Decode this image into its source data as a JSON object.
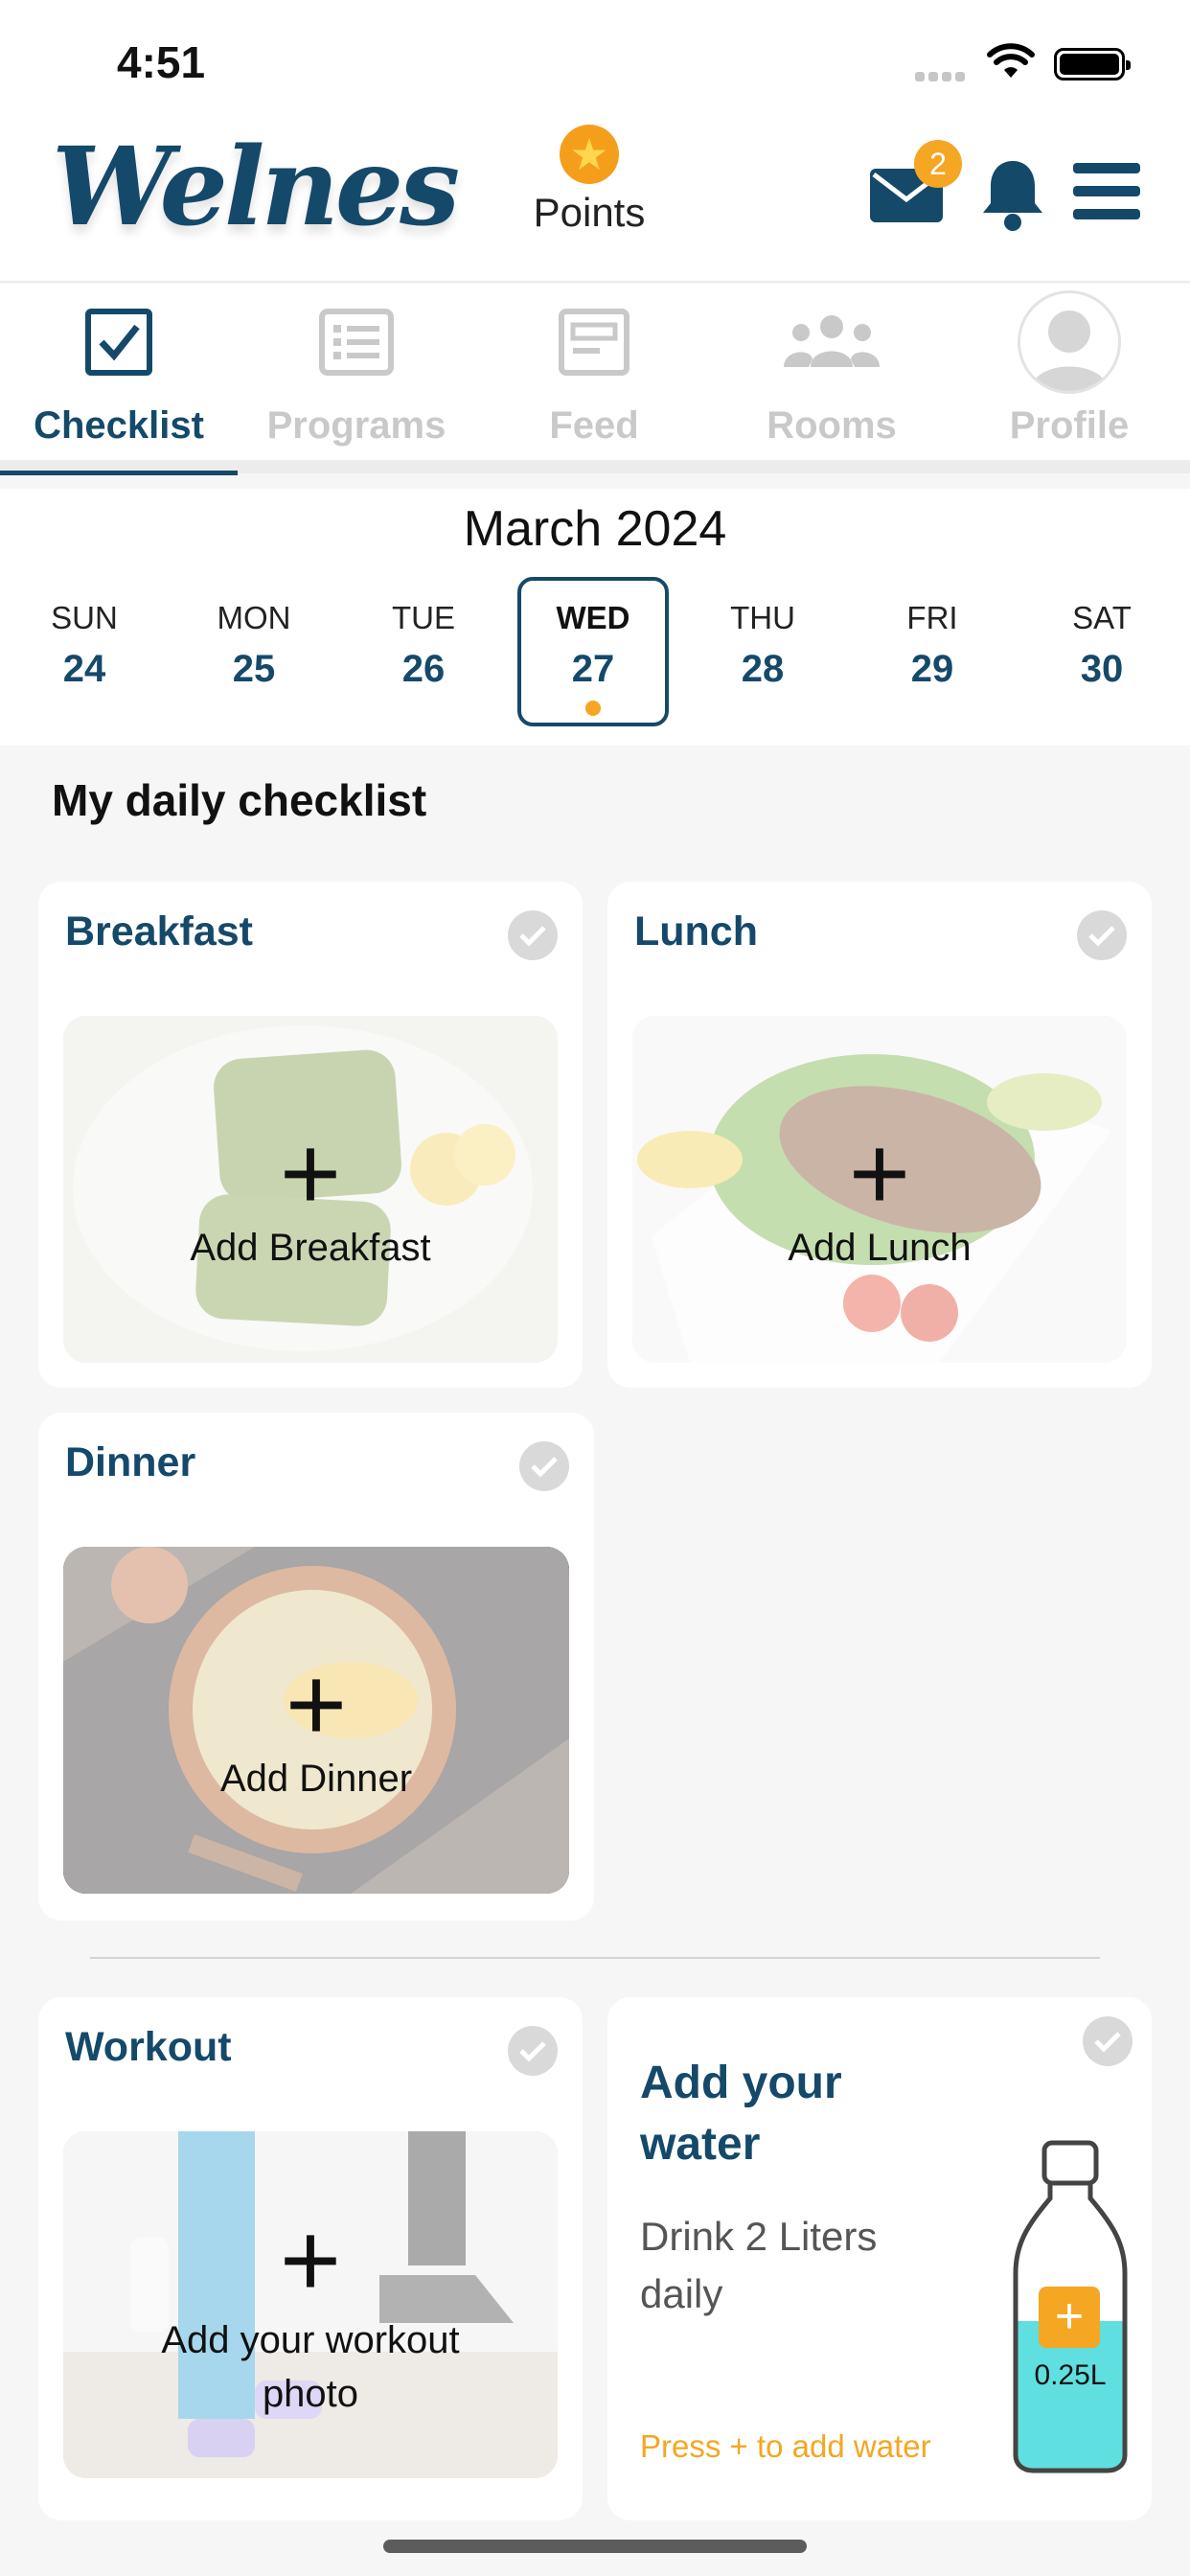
{
  "status_bar": {
    "time": "4:51"
  },
  "header": {
    "logo_text": "Welnes",
    "points_label": "Points",
    "mail_badge": "2"
  },
  "tabs": [
    {
      "label": "Checklist",
      "active": true
    },
    {
      "label": "Programs",
      "active": false
    },
    {
      "label": "Feed",
      "active": false
    },
    {
      "label": "Rooms",
      "active": false
    },
    {
      "label": "Profile",
      "active": false
    }
  ],
  "calendar": {
    "month": "March 2024",
    "days": [
      {
        "name": "SUN",
        "date": "24"
      },
      {
        "name": "MON",
        "date": "25"
      },
      {
        "name": "TUE",
        "date": "26"
      },
      {
        "name": "WED",
        "date": "27",
        "selected": true
      },
      {
        "name": "THU",
        "date": "28"
      },
      {
        "name": "FRI",
        "date": "29"
      },
      {
        "name": "SAT",
        "date": "30"
      }
    ]
  },
  "checklist": {
    "title": "My daily checklist",
    "breakfast": {
      "title": "Breakfast",
      "action": "Add Breakfast"
    },
    "lunch": {
      "title": "Lunch",
      "action": "Add Lunch"
    },
    "dinner": {
      "title": "Dinner",
      "action": "Add Dinner"
    },
    "workout": {
      "title": "Workout",
      "action": "Add your workout photo"
    },
    "water": {
      "title": "Add your water",
      "subtitle": "Drink 2 Liters daily",
      "hint": "Press + to add water",
      "amount": "0.25L",
      "plus": "+"
    }
  },
  "colors": {
    "brand": "#15496a",
    "accent": "#f5a623",
    "water": "#5fdfe0"
  }
}
